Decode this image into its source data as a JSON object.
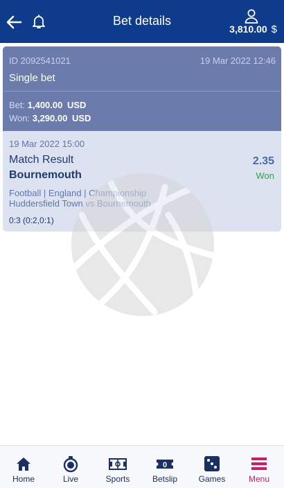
{
  "header": {
    "title": "Bet details",
    "balance": "3,810.00",
    "currency_symbol": "$"
  },
  "bet": {
    "id": "ID 2092541021",
    "datetime": "19 Mar 2022 12:46",
    "type": "Single bet",
    "stake_label": "Bet:",
    "stake_value": "1,400.00",
    "stake_currency": "USD",
    "won_label": "Won:",
    "won_value": "3,290.00",
    "won_currency": "USD"
  },
  "event": {
    "date": "19 Mar 2022 15:00",
    "market": "Match Result",
    "selection": "Bournemouth",
    "odds": "2.35",
    "status": "Won",
    "category_path": "Football | England | Championship",
    "teams": "Huddersfield Town vs Bournemouth",
    "score": "0:3 (0:2,0:1)"
  },
  "nav": {
    "items": [
      {
        "label": "Home",
        "icon": "home-icon"
      },
      {
        "label": "Live",
        "icon": "stopwatch-icon"
      },
      {
        "label": "Sports",
        "icon": "field-icon"
      },
      {
        "label": "Betslip",
        "icon": "ticket-icon",
        "count": "0"
      },
      {
        "label": "Games",
        "icon": "dice-icon"
      },
      {
        "label": "Menu",
        "icon": "menu-icon"
      }
    ],
    "active": "Menu"
  },
  "colors": {
    "header_bg": "#0f3b8c",
    "card_header_bg": "#6b7bab",
    "card_body_bg": "#dde2f0",
    "won_status": "#28a745",
    "active_nav": "#cc1d65"
  }
}
